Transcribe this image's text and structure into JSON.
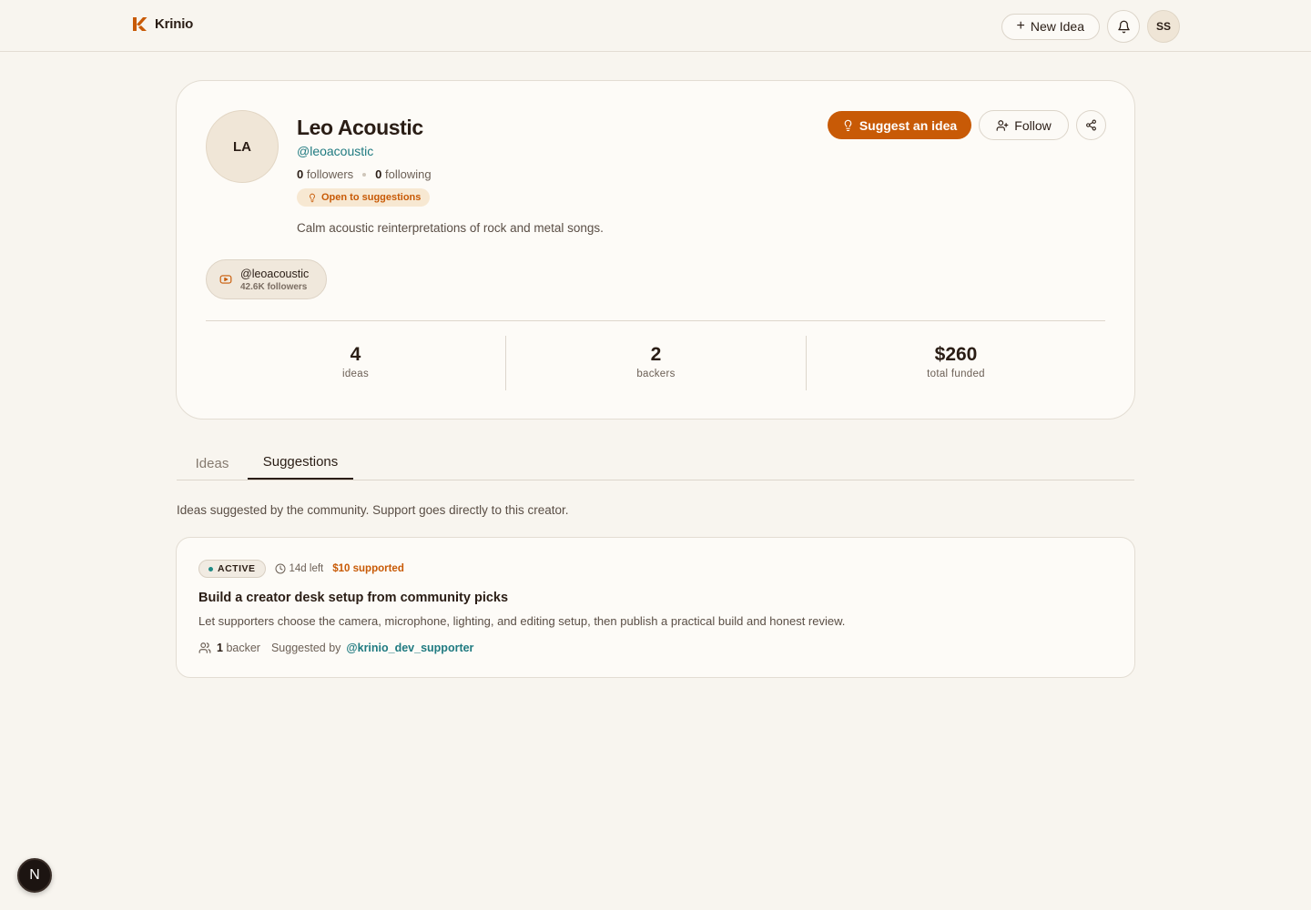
{
  "header": {
    "brand": "Krinio",
    "new_idea_label": "New Idea",
    "user_initials": "SS"
  },
  "profile": {
    "initials": "LA",
    "name": "Leo Acoustic",
    "handle": "@leoacoustic",
    "followers_count": "0",
    "followers_label": "followers",
    "following_count": "0",
    "following_label": "following",
    "open_badge": "Open to suggestions",
    "bio": "Calm acoustic reinterpretations of rock and metal songs.",
    "suggest_label": "Suggest an idea",
    "follow_label": "Follow",
    "social": {
      "platform_icon": "youtube-icon",
      "handle": "@leoacoustic",
      "followers": "42.6K followers"
    },
    "stats": [
      {
        "value": "4",
        "label": "ideas"
      },
      {
        "value": "2",
        "label": "backers"
      },
      {
        "value": "$260",
        "label": "total funded"
      }
    ]
  },
  "tabs": [
    {
      "label": "Ideas",
      "active": false
    },
    {
      "label": "Suggestions",
      "active": true
    }
  ],
  "tab_description": "Ideas suggested by the community. Support goes directly to this creator.",
  "suggestions": [
    {
      "status": "ACTIVE",
      "time_left": "14d left",
      "supported": "$10 supported",
      "title": "Build a creator desk setup from community picks",
      "description": "Let supporters choose the camera, microphone, lighting, and editing setup, then publish a practical build and honest review.",
      "backer_count": "1",
      "backer_label": "backer",
      "suggested_by_label": "Suggested by",
      "author": "@krinio_dev_supporter"
    }
  ],
  "dev_badge": "N",
  "colors": {
    "accent": "#c85a06",
    "link": "#1f7a80",
    "background": "#f8f5ef",
    "text": "#2a1d15"
  }
}
